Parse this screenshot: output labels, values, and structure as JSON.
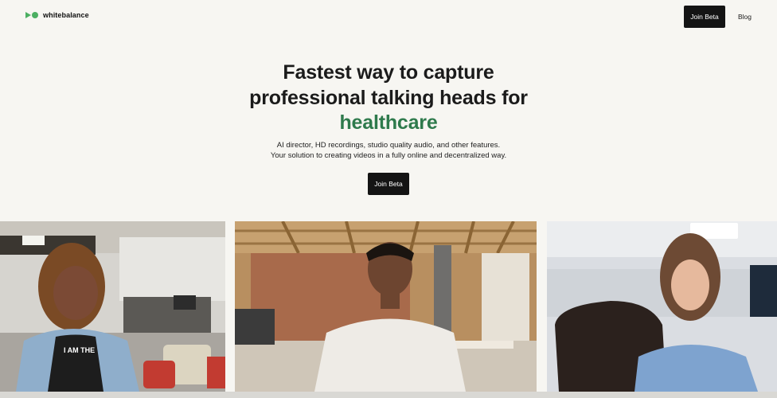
{
  "header": {
    "brand": "whitebalance",
    "join_label": "Join Beta",
    "blog_label": "Blog"
  },
  "hero": {
    "title_line1": "Fastest way to capture",
    "title_line2": "professional talking heads for",
    "title_accent": "healthcare",
    "subtitle_line1": "AI director, HD recordings, studio quality audio, and other features.",
    "subtitle_line2": "Your solution to creating videos in a fully online and decentralized way.",
    "cta_label": "Join Beta"
  },
  "colors": {
    "accent_green": "#2e7a4c",
    "logo_green": "#4caf62",
    "button_dark": "#141414",
    "background": "#f7f6f2"
  },
  "videos": [
    {
      "icon": "woman-talking-office-video"
    },
    {
      "icon": "man-talking-loft-video"
    },
    {
      "icon": "woman-talking-office-chair-video"
    }
  ]
}
